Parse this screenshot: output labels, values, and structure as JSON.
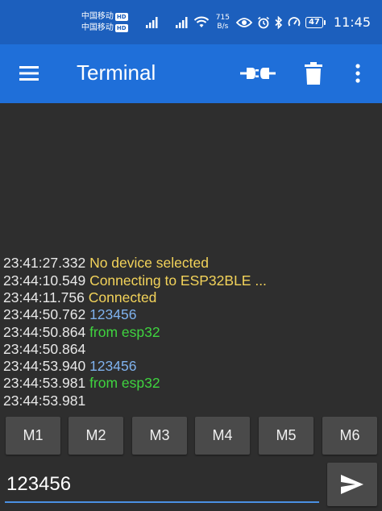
{
  "status_bar": {
    "carrier_1": "中国移动",
    "carrier_2": "中国移动",
    "hd_1": "HD",
    "hd_2": "HD",
    "net_1": "5G",
    "net_2": "4G",
    "speed_value": "715",
    "speed_unit": "B/s",
    "battery": "47",
    "time": "11:45"
  },
  "appbar": {
    "title": "Terminal"
  },
  "log": [
    {
      "time": "23:41:27.332",
      "text": "No device selected",
      "kind": "status"
    },
    {
      "time": "23:44:10.549",
      "text": "Connecting to ESP32BLE ...",
      "kind": "status"
    },
    {
      "time": "23:44:11.756",
      "text": "Connected",
      "kind": "status"
    },
    {
      "time": "23:44:50.762",
      "text": "123456",
      "kind": "sent"
    },
    {
      "time": "23:44:50.864",
      "text": "from esp32",
      "kind": "recv"
    },
    {
      "time": "23:44:50.864",
      "text": "",
      "kind": "recv"
    },
    {
      "time": "23:44:53.940",
      "text": "123456",
      "kind": "sent"
    },
    {
      "time": "23:44:53.981",
      "text": "from esp32",
      "kind": "recv"
    },
    {
      "time": "23:44:53.981",
      "text": "",
      "kind": "recv"
    }
  ],
  "macros": [
    "M1",
    "M2",
    "M3",
    "M4",
    "M5",
    "M6"
  ],
  "input": {
    "value": "123456"
  },
  "colors": {
    "appbar": "#1f6fd9",
    "status": "#f3d35a",
    "sent": "#7fb2ee",
    "recv": "#3fd43f"
  }
}
